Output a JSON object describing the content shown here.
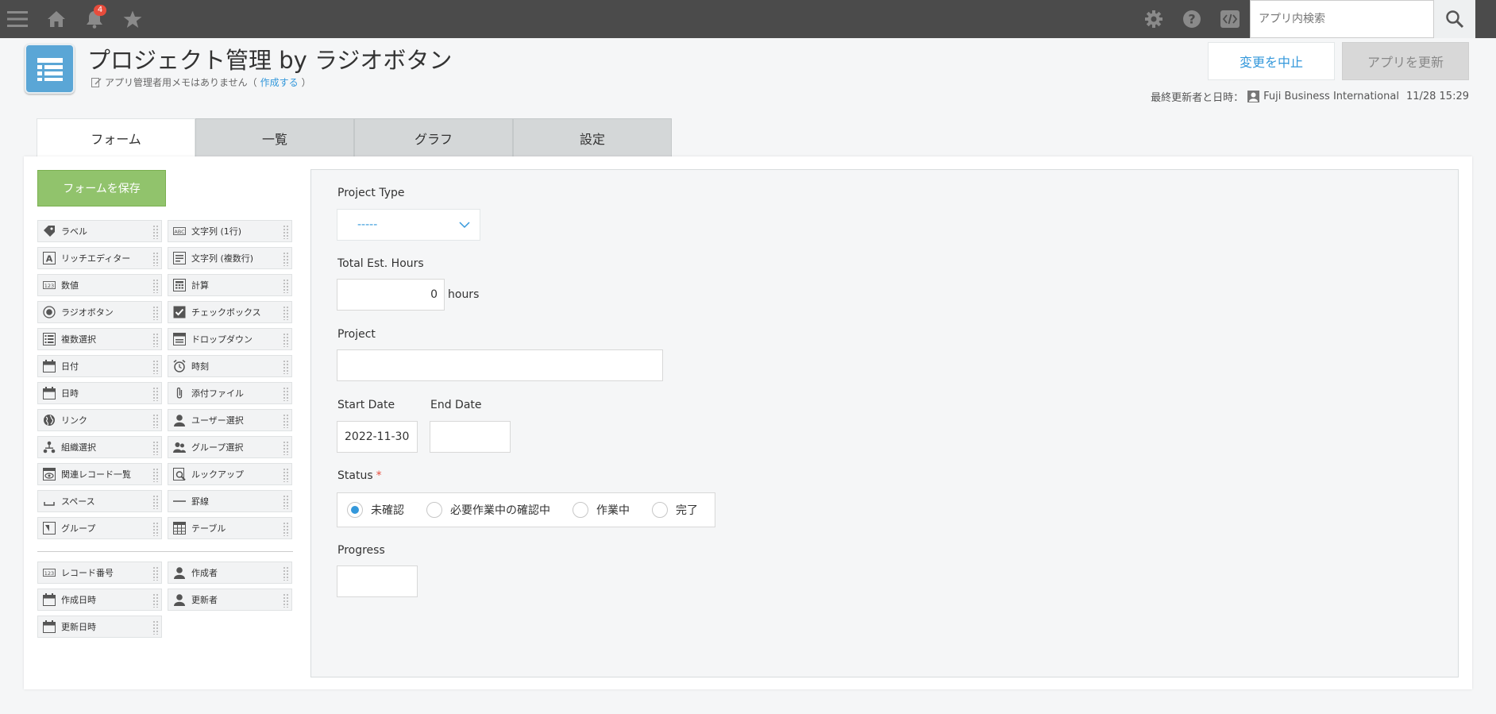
{
  "topbar": {
    "notification_count": "4",
    "search_placeholder": "アプリ内検索"
  },
  "header": {
    "title": "プロジェクト管理 by ラジオボタン",
    "memo_text": "アプリ管理者用メモはありません（",
    "memo_link": "作成する",
    "memo_close": "）",
    "cancel_label": "変更を中止",
    "update_label": "アプリを更新",
    "last_updated_label": "最終更新者と日時：",
    "last_updated_user": "Fuji Business International",
    "last_updated_time": "11/28 15:29"
  },
  "tabs": [
    "フォーム",
    "一覧",
    "グラフ",
    "設定"
  ],
  "palette": {
    "save_label": "フォームを保存",
    "items": [
      {
        "label": "ラベル",
        "icon": "tag-icon"
      },
      {
        "label": "文字列 (1行)",
        "icon": "abc-icon"
      },
      {
        "label": "リッチエディター",
        "icon": "rich-text-icon"
      },
      {
        "label": "文字列 (複数行)",
        "icon": "multiline-text-icon"
      },
      {
        "label": "数値",
        "icon": "number-icon"
      },
      {
        "label": "計算",
        "icon": "calculator-icon"
      },
      {
        "label": "ラジオボタン",
        "icon": "radio-icon"
      },
      {
        "label": "チェックボックス",
        "icon": "checkbox-icon"
      },
      {
        "label": "複数選択",
        "icon": "multi-select-icon"
      },
      {
        "label": "ドロップダウン",
        "icon": "dropdown-icon"
      },
      {
        "label": "日付",
        "icon": "calendar-icon"
      },
      {
        "label": "時刻",
        "icon": "clock-icon"
      },
      {
        "label": "日時",
        "icon": "datetime-icon"
      },
      {
        "label": "添付ファイル",
        "icon": "paperclip-icon"
      },
      {
        "label": "リンク",
        "icon": "globe-icon"
      },
      {
        "label": "ユーザー選択",
        "icon": "user-icon"
      },
      {
        "label": "組織選択",
        "icon": "org-icon"
      },
      {
        "label": "グループ選択",
        "icon": "group-icon"
      },
      {
        "label": "関連レコード一覧",
        "icon": "related-records-icon"
      },
      {
        "label": "ルックアップ",
        "icon": "lookup-icon"
      },
      {
        "label": "スペース",
        "icon": "space-icon"
      },
      {
        "label": "罫線",
        "icon": "line-icon"
      },
      {
        "label": "グループ",
        "icon": "group-field-icon"
      },
      {
        "label": "テーブル",
        "icon": "table-icon"
      }
    ],
    "system_items": [
      {
        "label": "レコード番号",
        "icon": "number-icon"
      },
      {
        "label": "作成者",
        "icon": "user-icon"
      },
      {
        "label": "作成日時",
        "icon": "calendar-icon"
      },
      {
        "label": "更新者",
        "icon": "user-icon"
      },
      {
        "label": "更新日時",
        "icon": "calendar-icon"
      }
    ]
  },
  "form": {
    "project_type_label": "Project Type",
    "project_type_value": "-----",
    "hours_label": "Total Est. Hours",
    "hours_value": "0",
    "hours_unit": "hours",
    "project_label": "Project",
    "start_date_label": "Start Date",
    "start_date_value": "2022-11-30",
    "end_date_label": "End Date",
    "status_label": "Status",
    "status_required": "*",
    "status_options": [
      "未確認",
      "必要作業中の確認中",
      "作業中",
      "完了"
    ],
    "status_selected": "未確認",
    "progress_label": "Progress"
  },
  "colors": {
    "accent": "#3498db",
    "save_green": "#91c36c",
    "topbar": "#4b4b4b",
    "required": "#e74c3c"
  }
}
